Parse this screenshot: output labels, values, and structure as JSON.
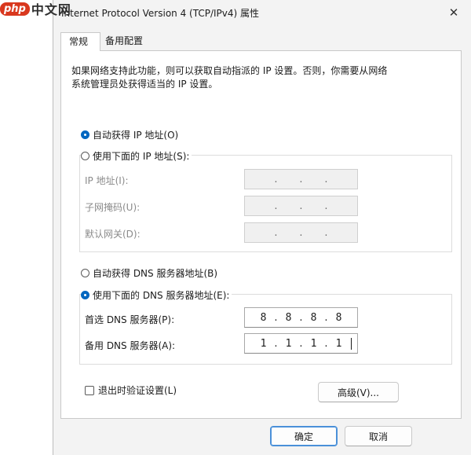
{
  "watermark": {
    "logo": "php",
    "text": "中文网"
  },
  "window": {
    "title": "Internet Protocol Version 4 (TCP/IPv4) 属性",
    "close_glyph": "✕"
  },
  "tabs": [
    {
      "label": "常规",
      "active": true
    },
    {
      "label": "备用配置",
      "active": false
    }
  ],
  "description": "如果网络支持此功能，则可以获取自动指派的 IP 设置。否则，你需要从网络系统管理员处获得适当的 IP 设置。",
  "ip_section": {
    "auto_radio_label": "自动获得 IP 地址(O)",
    "manual_radio_label": "使用下面的 IP 地址(S):",
    "selected": "auto",
    "fields": [
      {
        "label": "IP 地址(I):",
        "octets": [
          "",
          "",
          "",
          ""
        ]
      },
      {
        "label": "子网掩码(U):",
        "octets": [
          "",
          "",
          "",
          ""
        ]
      },
      {
        "label": "默认网关(D):",
        "octets": [
          "",
          "",
          "",
          ""
        ]
      }
    ]
  },
  "dns_section": {
    "auto_radio_label": "自动获得 DNS 服务器地址(B)",
    "manual_radio_label": "使用下面的 DNS 服务器地址(E):",
    "selected": "manual",
    "fields": [
      {
        "label": "首选 DNS 服务器(P):",
        "octets": [
          "8",
          "8",
          "8",
          "8"
        ]
      },
      {
        "label": "备用 DNS 服务器(A):",
        "octets": [
          "1",
          "1",
          "1",
          "1"
        ]
      }
    ]
  },
  "validate_checkbox": {
    "label": "退出时验证设置(L)",
    "checked": false
  },
  "advanced_button": "高级(V)...",
  "ok_button": "确定",
  "cancel_button": "取消",
  "ip_separator": "."
}
